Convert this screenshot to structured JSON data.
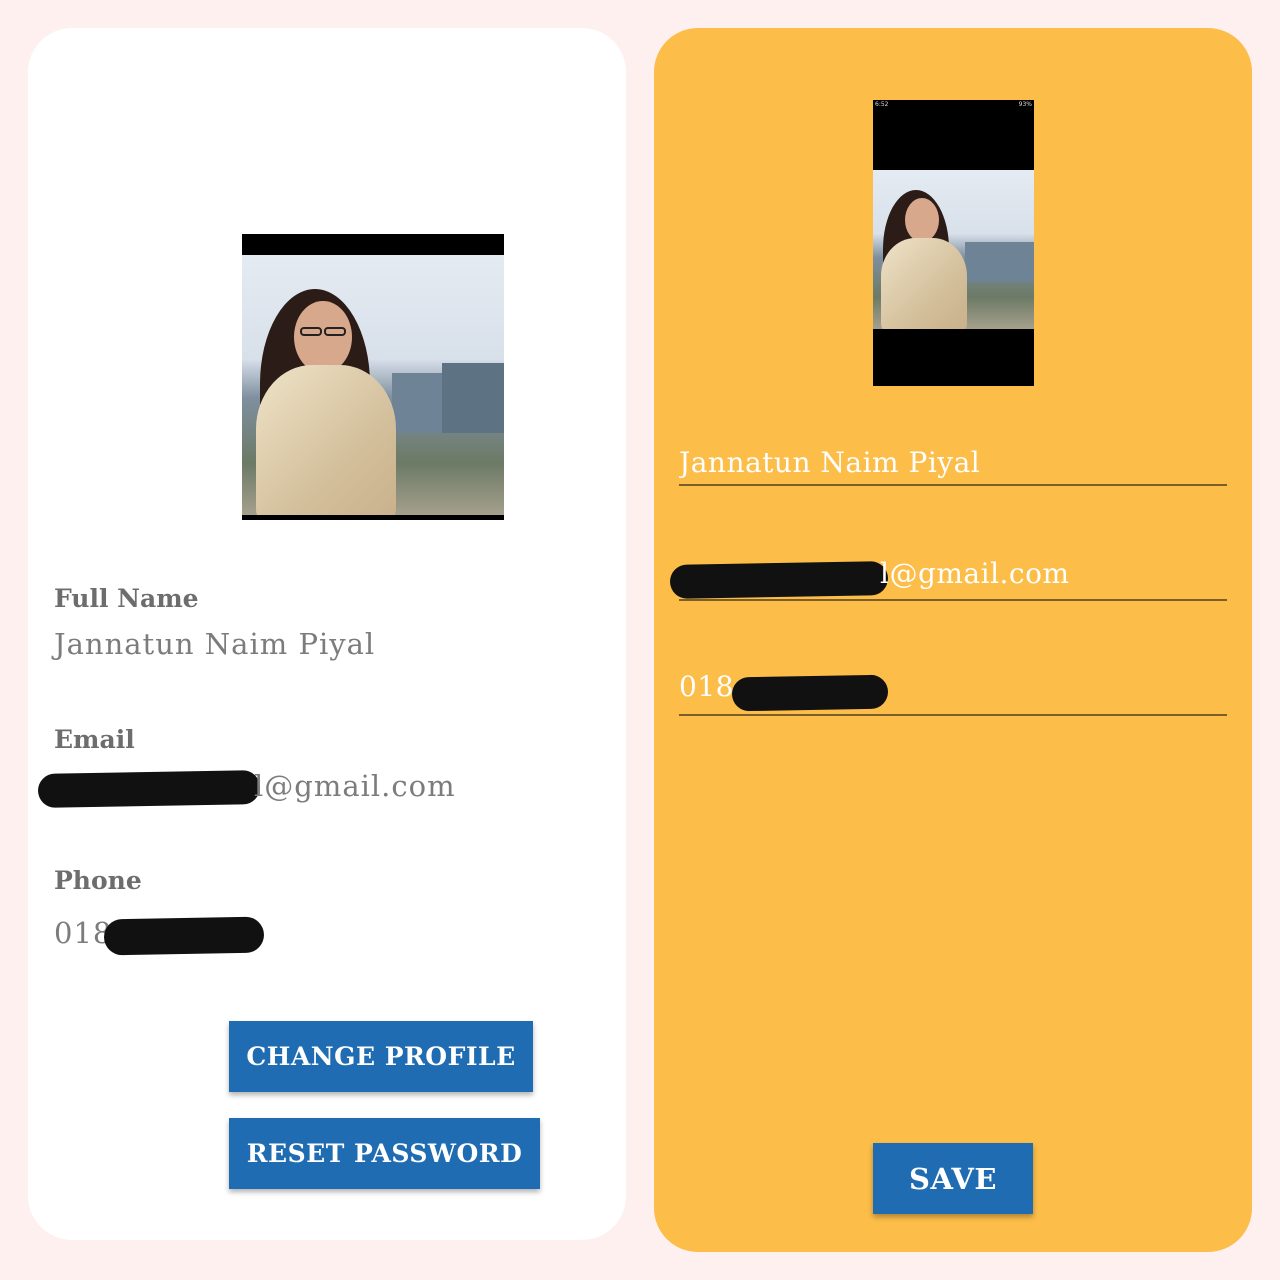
{
  "profile_view": {
    "full_name_label": "Full Name",
    "full_name_value": "Jannatun Naim Piyal",
    "email_label": "Email",
    "email_visible": "l@gmail.com",
    "phone_label": "Phone",
    "phone_visible": "018",
    "change_profile_label": "CHANGE PROFILE",
    "reset_password_label": "RESET PASSWORD"
  },
  "edit_view": {
    "status_time": "6:52",
    "status_battery": "93%",
    "name_value": "Jannatun Naim Piyal",
    "email_visible": "l@gmail.com",
    "phone_visible": "018",
    "save_label": "SAVE"
  },
  "colors": {
    "background": "#fdf0ef",
    "left_panel": "#ffffff",
    "right_panel": "#fcbd49",
    "button": "#1f6cb3"
  }
}
